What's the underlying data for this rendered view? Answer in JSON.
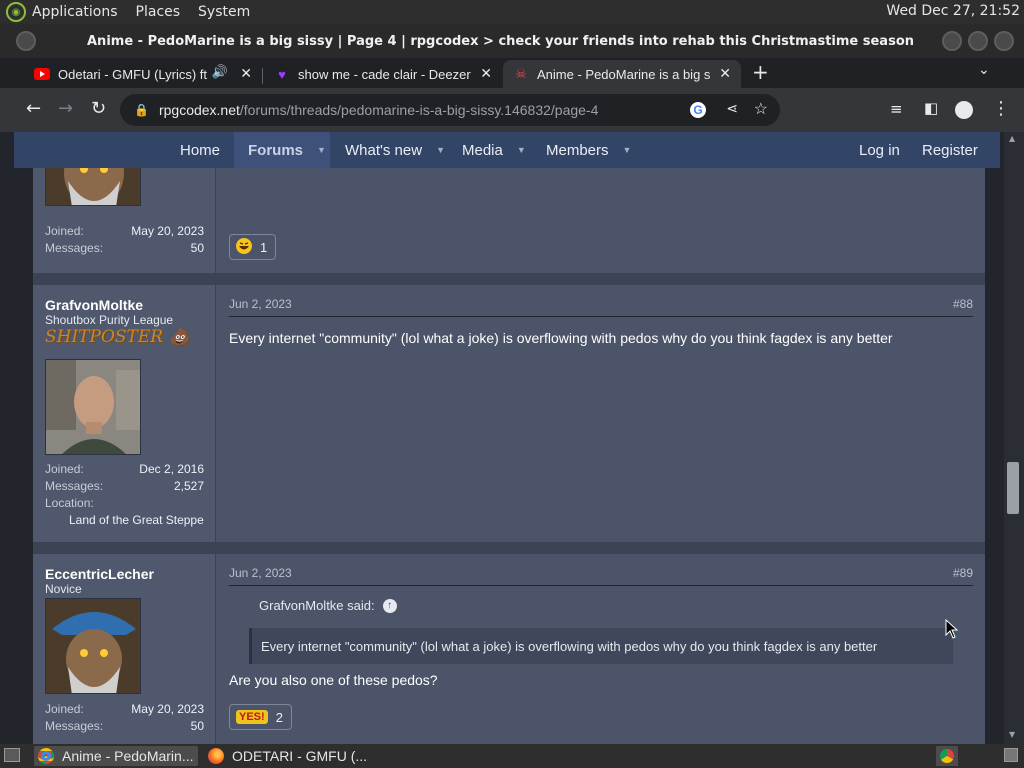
{
  "top_panel": {
    "menus": [
      "Applications",
      "Places",
      "System"
    ],
    "clock": "Wed Dec 27, 21:52"
  },
  "window": {
    "title": "Anime - PedoMarine is a big sissy | Page 4 | rpgcodex > check your friends into rehab this Christmastime season holiday - Google Chrome"
  },
  "tabs": [
    {
      "label": "Odetari - GMFU (Lyrics) ft",
      "icon": "youtube-icon"
    },
    {
      "label": "show me - cade clair - Deezer",
      "icon": "deezer-heart-icon"
    },
    {
      "label": "Anime - PedoMarine is a big s",
      "icon": "rpgcodex-icon"
    }
  ],
  "address": {
    "host": "rpgcodex.net",
    "path": "/forums/threads/pedomarine-is-a-big-sissy.146832/page-4"
  },
  "nav": {
    "home": "Home",
    "forums": "Forums",
    "whats_new": "What's new",
    "media": "Media",
    "members": "Members",
    "login": "Log in",
    "register": "Register"
  },
  "post0": {
    "joined_label": "Joined:",
    "joined": "May 20, 2023",
    "messages_label": "Messages:",
    "messages": "50",
    "reaction_count": "1"
  },
  "post88": {
    "username": "GrafvonMoltke",
    "title": "Shoutbox Purity League",
    "banner": "SHITPOSTER",
    "joined_label": "Joined:",
    "joined": "Dec 2, 2016",
    "messages_label": "Messages:",
    "messages": "2,527",
    "location_label": "Location:",
    "location": "Land of the Great Steppe",
    "date": "Jun 2, 2023",
    "number": "#88",
    "body": "Every internet \"community\" (lol what a joke) is overflowing with pedos why do you think fagdex is any better"
  },
  "post89": {
    "username": "EccentricLecher",
    "title": "Novice",
    "joined_label": "Joined:",
    "joined": "May 20, 2023",
    "messages_label": "Messages:",
    "messages": "50",
    "date": "Jun 2, 2023",
    "number": "#89",
    "quote_author": "GrafvonMoltke said:",
    "quote_text": "Every internet \"community\" (lol what a joke) is overflowing with pedos why do you think fagdex is any better",
    "body": "Are you also one of these pedos?",
    "reaction_label": "YES!",
    "reaction_count": "2"
  },
  "taskbar": [
    {
      "label": "Anime - PedoMarin...",
      "icon": "chrome-icon"
    },
    {
      "label": "ODETARI - GMFU (...",
      "icon": "firefox-icon"
    }
  ],
  "colors": {
    "nav_bg": "#334566",
    "post_bg": "#4b5468",
    "accent_banner": "#c9862a"
  }
}
